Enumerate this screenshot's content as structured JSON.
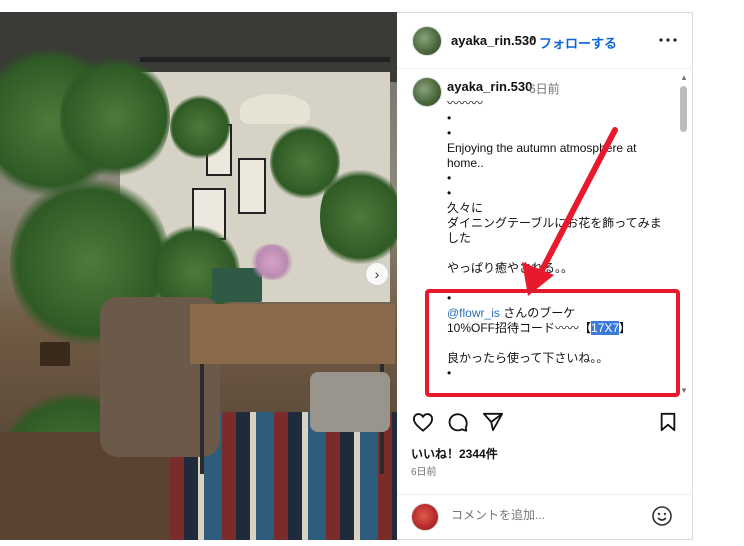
{
  "post": {
    "username": "ayaka_rin.530",
    "follow_label": "フォローする",
    "separator": "•",
    "more_label": "•••"
  },
  "comment": {
    "username": "ayaka_rin.530",
    "time": "6日前",
    "caption_line1": "〰〰〰",
    "caption_bullets1": "•\n•",
    "caption_en": "Enjoying the autumn atmosphere at home..",
    "caption_bullets2": "•\n•",
    "caption_jp1": "久々に\nダイニングテーブルにお花を飾ってみました",
    "caption_jp2": "やっぱり癒やされる。。",
    "caption_bullet3": "•",
    "mention": "@flowr_is",
    "mention_suffix": " さんのブーケ",
    "code_line_prefix": "10%OFF招待コード〰〰【",
    "code": "17X7",
    "code_line_suffix": "】",
    "caption_jp3": "良かったら使って下さいね。。",
    "caption_bullet4": "•"
  },
  "stats": {
    "likes": "いいね！2344件",
    "days_ago": "6日前"
  },
  "comment_input": {
    "placeholder": "コメントを追加..."
  },
  "icons": {
    "like": "heart-icon",
    "comment": "comment-bubble-icon",
    "share": "paper-plane-icon",
    "save": "bookmark-icon",
    "emoji": "emoji-smile-icon",
    "carousel": "chevron-right-icon"
  },
  "colors": {
    "annotation": "#e8192c",
    "link": "#0a66d8",
    "highlight": "#3b7ad8"
  }
}
